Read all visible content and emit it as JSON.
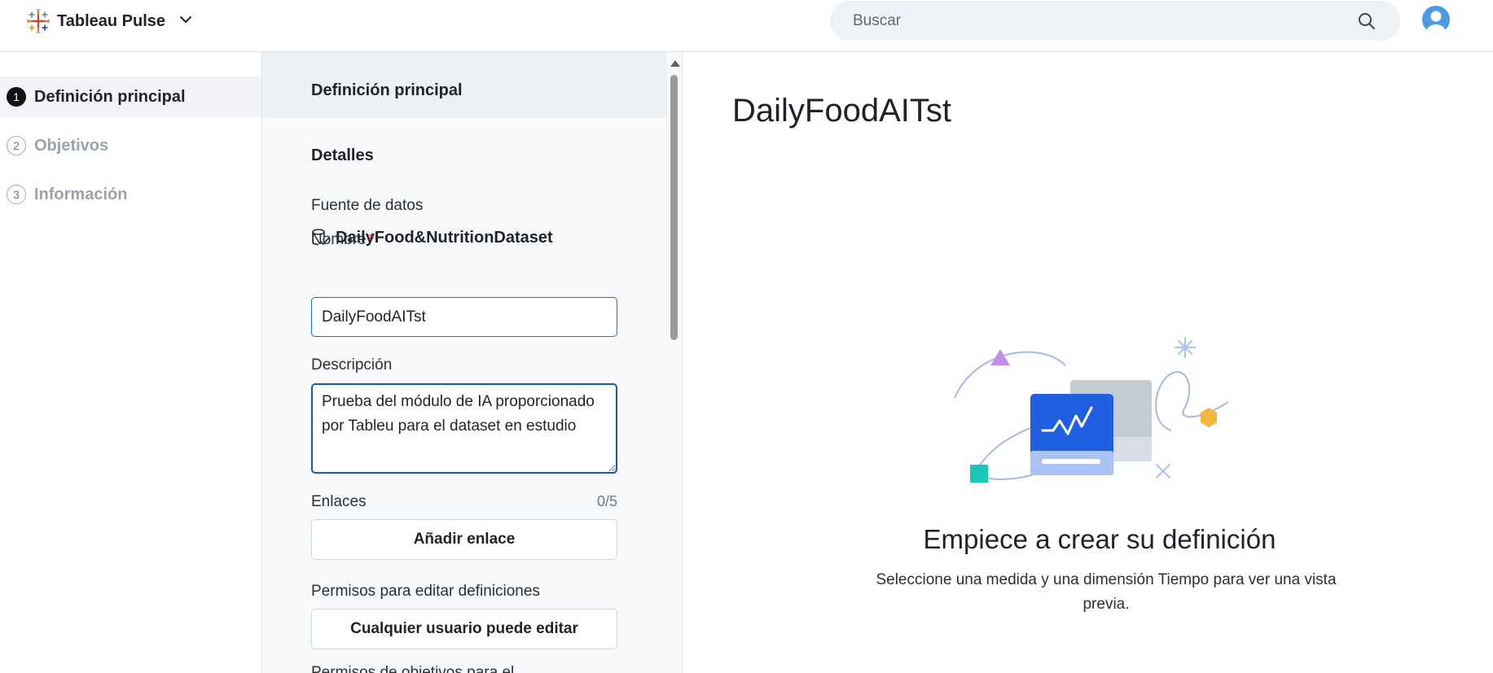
{
  "header": {
    "app_name": "Tableau Pulse",
    "search_placeholder": "Buscar"
  },
  "steps": [
    {
      "number": "1",
      "label": "Definición principal",
      "active": true
    },
    {
      "number": "2",
      "label": "Objetivos",
      "active": false
    },
    {
      "number": "3",
      "label": "Información",
      "active": false
    }
  ],
  "form": {
    "header_title": "Definición principal",
    "section_title": "Detalles",
    "datasource_label": "Fuente de datos",
    "datasource_name": "DailyFood&NutritionDataset",
    "name_label": "Nombre",
    "required_mark": "*",
    "name_value": "DailyFoodAITst",
    "description_label": "Descripción",
    "description_value": "Prueba del módulo de IA proporcionado por Tableu para el dataset en estudio",
    "links_label": "Enlaces",
    "links_counter": "0/5",
    "add_link_button": "Añadir enlace",
    "permissions_label": "Permisos para editar definiciones",
    "permissions_button": "Cualquier usuario puede editar",
    "next_label_partial": "Permisos de objetivos para el..."
  },
  "preview": {
    "title": "DailyFoodAITst",
    "empty_title": "Empiece a crear su definición",
    "empty_text": "Seleccione una medida y una dimensión Tiempo para ver una vista previa."
  },
  "colors": {
    "accent_blue": "#1a73c8",
    "illustration_blue": "#1f5fe0",
    "required_red": "#c8102e"
  }
}
